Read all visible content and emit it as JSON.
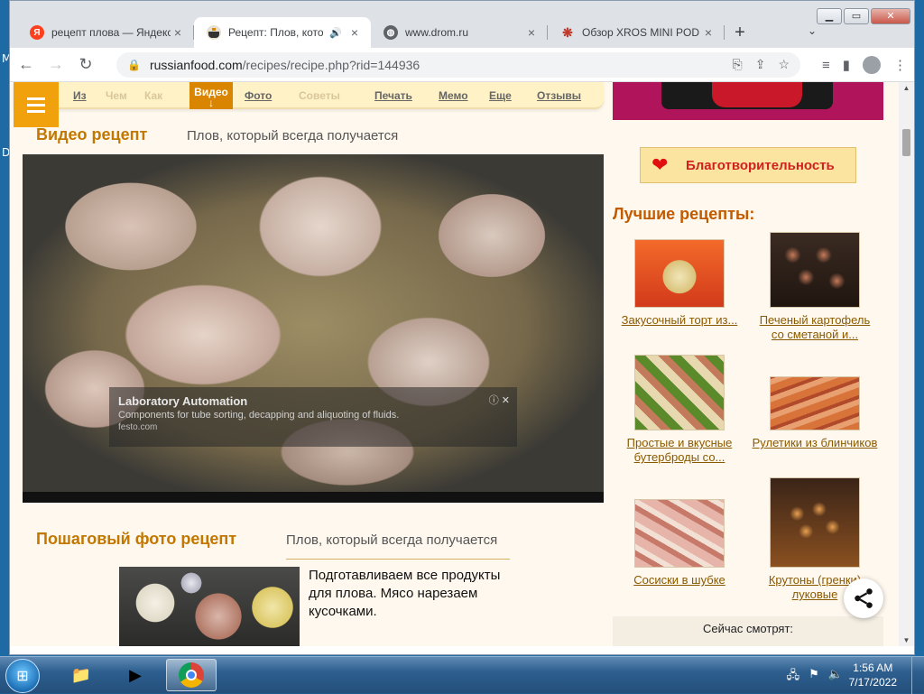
{
  "desktop": {
    "left_letters": [
      "M",
      "D"
    ]
  },
  "browser": {
    "window_controls": {
      "minimize": "▁",
      "maximize": "▭",
      "close": "✕"
    },
    "tabs": [
      {
        "title": "рецепт плова — Яндекс",
        "favicon": "Я",
        "favicon_color": "#fc3f1d",
        "active": false
      },
      {
        "title": "Рецепт: Плов, который",
        "favicon": "pot-icon",
        "favicon_color": "#333333",
        "active": true,
        "audio": "🔊"
      },
      {
        "title": "www.drom.ru",
        "favicon": "globe-icon",
        "favicon_color": "#5f6368",
        "active": false
      },
      {
        "title": "Обзор XROS MINI POD",
        "favicon": "snowflake-icon",
        "favicon_color": "#c0392b",
        "active": false
      }
    ],
    "new_tab": "+",
    "tab_search": "⌄",
    "url_host": "russianfood.com",
    "url_path": "/recipes/recipe.php?rid=144936"
  },
  "subnav": {
    "items": [
      {
        "label": "Из",
        "faded": false
      },
      {
        "label": "Чем",
        "faded": true
      },
      {
        "label": "Как",
        "faded": true
      },
      {
        "label": "Фото",
        "faded": false
      },
      {
        "label": "Советы",
        "faded": true
      },
      {
        "label": "Печать",
        "faded": false
      },
      {
        "label": "Мемо",
        "faded": false
      },
      {
        "label": "Еще",
        "faded": false
      },
      {
        "label": "Отзывы",
        "faded": false
      }
    ],
    "active_label": "Видео",
    "active_arrow": "↓"
  },
  "video_section": {
    "title": "Видео рецепт",
    "subtitle": "Плов, который всегда получается",
    "ad": {
      "title": "Laboratory Automation",
      "description": "Components for tube sorting, decapping and aliquoting of fluids.",
      "source": "festo.com",
      "close": "ⓘ ✕"
    }
  },
  "photo_section": {
    "title": "Пошаговый фото рецепт",
    "subtitle": "Плов, который всегда получается",
    "step_text": "Подготавливаем все продукты для плова. Мясо нарезаем кусочками."
  },
  "sidebar": {
    "charity_label": "Благотворительность",
    "best_title": "Лучшие рецепты:",
    "cards": [
      {
        "caption": "Закусочный торт из...",
        "color": "#e94a20"
      },
      {
        "caption": "Печеный картофель со сметаной и...",
        "color": "#3a2a22"
      },
      {
        "caption": "Простые и вкусные бутерброды со...",
        "color": "#6a8a3a"
      },
      {
        "caption": "Рулетики из блинчиков",
        "color": "#c46a3a"
      },
      {
        "caption": "Сосиски в шубке",
        "color": "#d88a7a"
      },
      {
        "caption": "Крутоны (гренки) луковые",
        "color": "#b8762a"
      }
    ],
    "watching_now": "Сейчас смотрят:"
  },
  "taskbar": {
    "time": "1:56 AM",
    "date": "7/17/2022"
  }
}
